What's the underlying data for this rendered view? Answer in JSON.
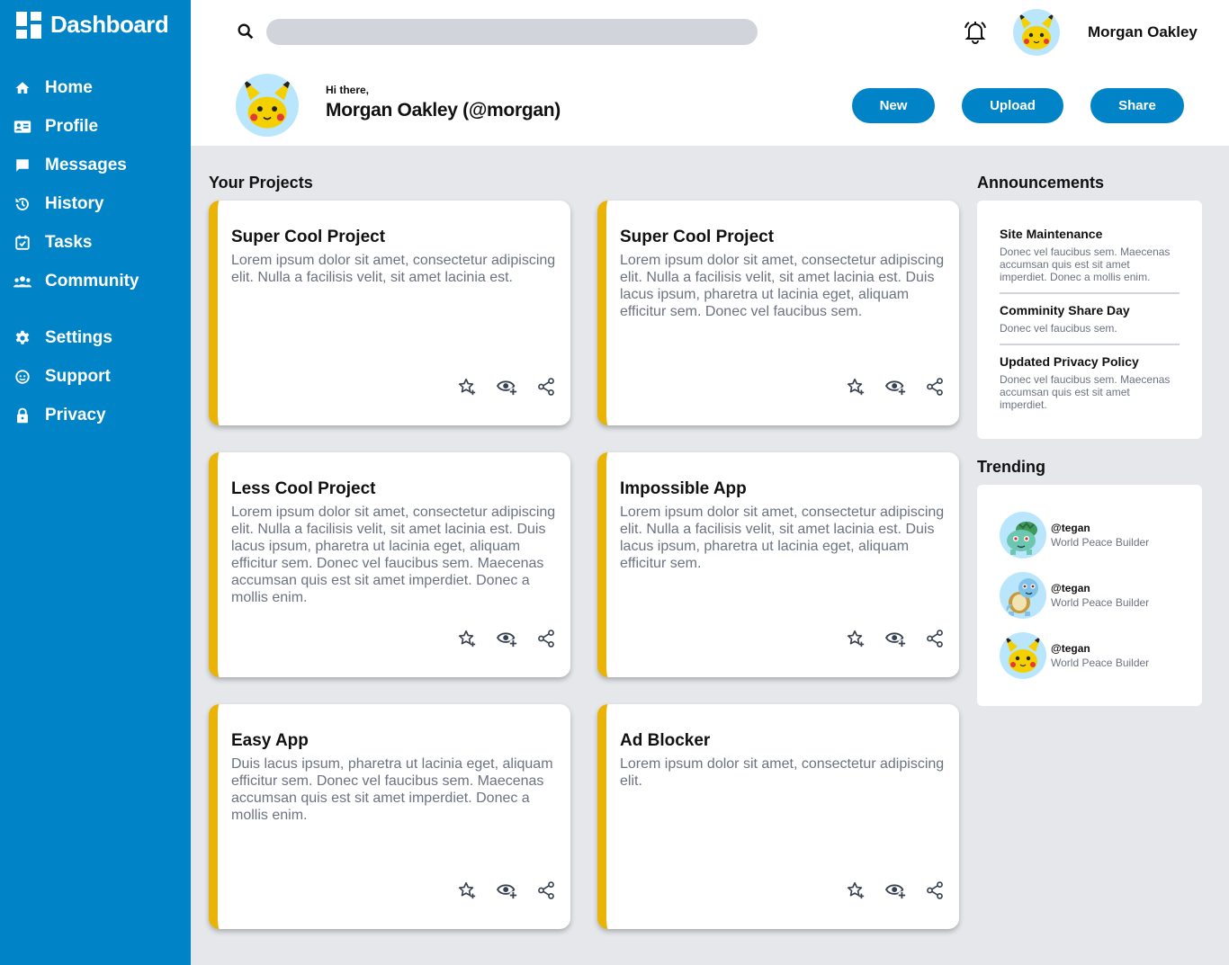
{
  "app": {
    "title": "Dashboard"
  },
  "sidebar": {
    "items": [
      {
        "label": "Home",
        "icon": "home-icon"
      },
      {
        "label": "Profile",
        "icon": "id-card-icon"
      },
      {
        "label": "Messages",
        "icon": "message-icon"
      },
      {
        "label": "History",
        "icon": "history-icon"
      },
      {
        "label": "Tasks",
        "icon": "calendar-check-icon"
      },
      {
        "label": "Community",
        "icon": "people-icon"
      },
      {
        "label": "Settings",
        "icon": "gear-icon"
      },
      {
        "label": "Support",
        "icon": "support-icon"
      },
      {
        "label": "Privacy",
        "icon": "lock-icon"
      }
    ]
  },
  "header": {
    "search_placeholder": "",
    "user_name": "Morgan Oakley",
    "greeting": "Hi there,",
    "greeting_name": "Morgan Oakley (@morgan)",
    "buttons": {
      "new": "New",
      "upload": "Upload",
      "share": "Share"
    }
  },
  "projects": {
    "title": "Your Projects",
    "cards": [
      {
        "title": "Super Cool Project",
        "description": "Lorem ipsum dolor sit amet, consectetur adipiscing elit. Nulla a facilisis velit, sit amet lacinia est."
      },
      {
        "title": "Super Cool Project",
        "description": "Lorem ipsum dolor sit amet, consectetur adipiscing elit. Nulla a facilisis velit, sit amet lacinia est. Duis lacus ipsum, pharetra ut lacinia eget, aliquam efficitur sem. Donec vel faucibus sem."
      },
      {
        "title": "Less Cool Project",
        "description": "Lorem ipsum dolor sit amet, consectetur adipiscing elit. Nulla a facilisis velit, sit amet lacinia est. Duis lacus ipsum, pharetra ut lacinia eget, aliquam efficitur sem. Donec vel faucibus sem. Maecenas accumsan quis est sit amet imperdiet. Donec a mollis enim."
      },
      {
        "title": "Impossible App",
        "description": "Lorem ipsum dolor sit amet, consectetur adipiscing elit. Nulla a facilisis velit, sit amet lacinia est. Duis lacus ipsum, pharetra ut lacinia eget, aliquam efficitur sem."
      },
      {
        "title": "Easy App",
        "description": "Duis lacus ipsum, pharetra ut lacinia eget, aliquam efficitur sem. Donec vel faucibus sem. Maecenas accumsan quis est sit amet imperdiet. Donec a mollis enim."
      },
      {
        "title": "Ad Blocker",
        "description": "Lorem ipsum dolor sit amet, consectetur adipiscing elit."
      }
    ]
  },
  "announcements": {
    "title": "Announcements",
    "items": [
      {
        "title": "Site Maintenance",
        "text": "Donec vel faucibus sem. Maecenas accumsan quis est sit amet imperdiet. Donec a mollis enim."
      },
      {
        "title": "Comminity Share Day",
        "text": "Donec vel faucibus sem."
      },
      {
        "title": "Updated Privacy Policy",
        "text": "Donec vel faucibus sem. Maecenas accumsan quis est sit amet imperdiet."
      }
    ]
  },
  "trending": {
    "title": "Trending",
    "items": [
      {
        "handle": "@tegan",
        "subtitle": "World Peace Builder",
        "avatar": "green-creature-avatar"
      },
      {
        "handle": "@tegan",
        "subtitle": "World Peace Builder",
        "avatar": "turtle-creature-avatar"
      },
      {
        "handle": "@tegan",
        "subtitle": "World Peace Builder",
        "avatar": "yellow-creature-avatar"
      }
    ]
  },
  "colors": {
    "primary": "#0084c7",
    "accent": "#eab308",
    "background": "#e5e7eb",
    "avatar_bg": "#bae6fd"
  }
}
